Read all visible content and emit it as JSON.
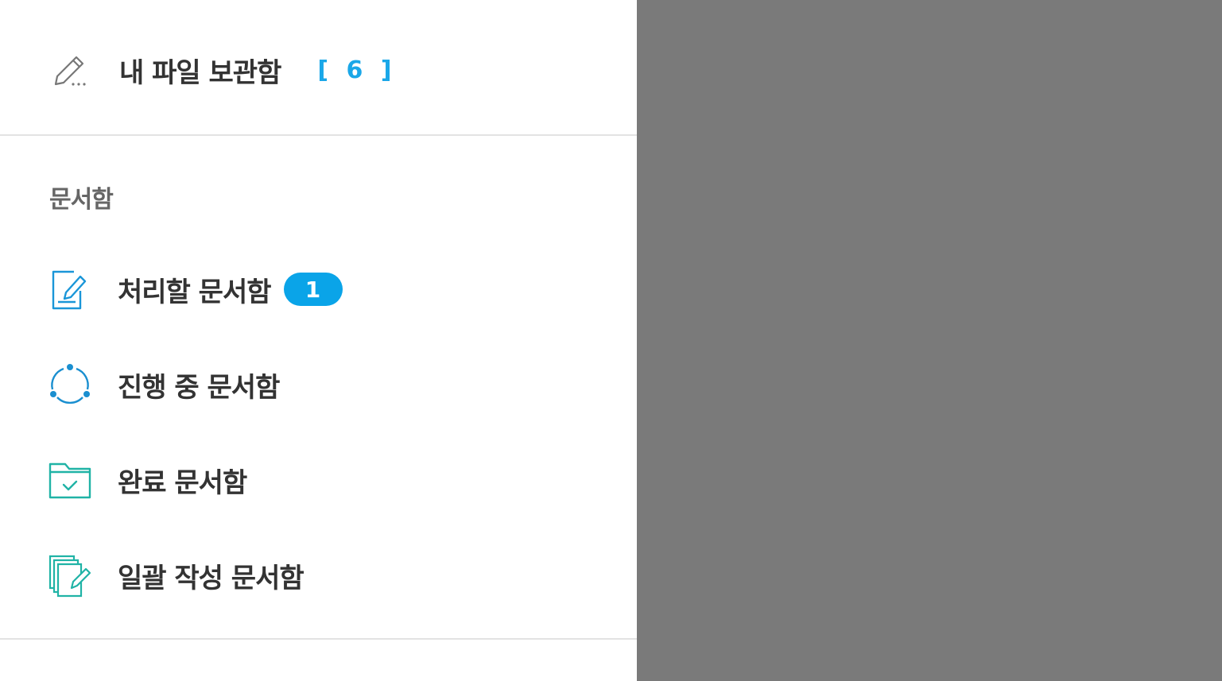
{
  "file_storage": {
    "label": "내 파일 보관함",
    "count": "[ 6 ]",
    "icon": "pencil-icon"
  },
  "documents": {
    "section_title": "문서함",
    "items": [
      {
        "label": "처리할 문서함",
        "badge": "1",
        "icon": "edit-document-icon",
        "color": "#1a96d8"
      },
      {
        "label": "진행 중 문서함",
        "icon": "progress-cycle-icon",
        "color": "#1a8fd0"
      },
      {
        "label": "완료 문서함",
        "icon": "folder-check-icon",
        "color": "#20b3a6"
      },
      {
        "label": "일괄 작성 문서함",
        "icon": "multi-document-edit-icon",
        "color": "#20b3a6"
      }
    ]
  },
  "colors": {
    "accent": "#0aa4e8",
    "overlay": "#7a7a7a",
    "text": "#333333",
    "divider": "#e3e3e3"
  }
}
